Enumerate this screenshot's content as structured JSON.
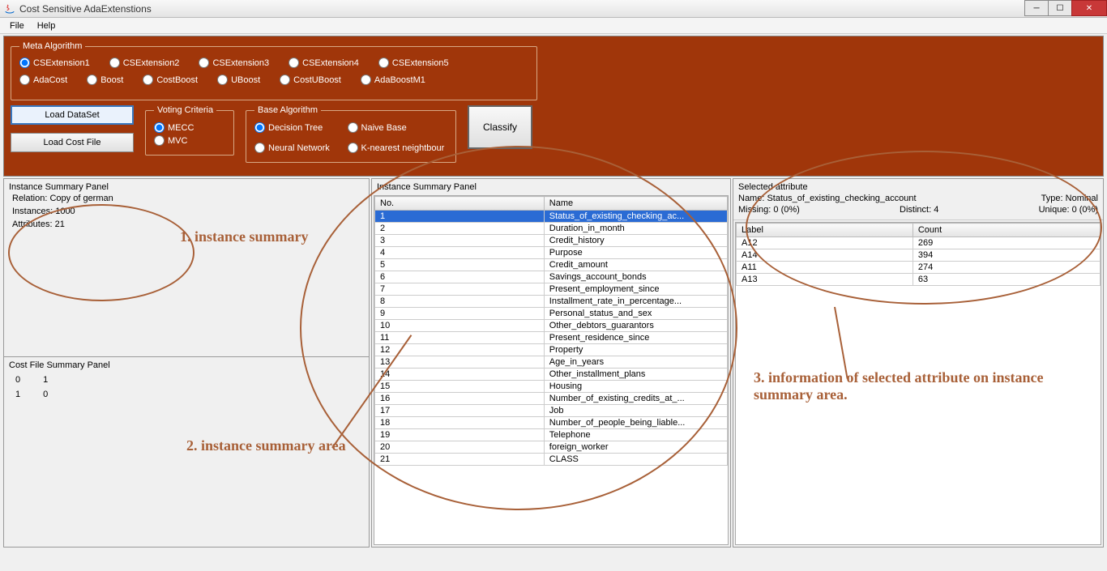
{
  "window": {
    "title": "Cost Sensitive AdaExtenstions"
  },
  "menu": {
    "file": "File",
    "help": "Help"
  },
  "meta": {
    "legend": "Meta Algorithm",
    "row1": [
      "CSExtension1",
      "CSExtension2",
      "CSExtension3",
      "CSExtension4",
      "CSExtension5"
    ],
    "row2": [
      "AdaCost",
      "Boost",
      "CostBoost",
      "UBoost",
      "CostUBoost",
      "AdaBoostM1"
    ],
    "selected": "CSExtension1"
  },
  "buttons": {
    "load_dataset": "Load DataSet",
    "load_costfile": "Load Cost File",
    "classify": "Classify"
  },
  "voting": {
    "legend": "Voting Criteria",
    "options": [
      "MECC",
      "MVC"
    ],
    "selected": "MECC"
  },
  "base": {
    "legend": "Base Algorithm",
    "options": [
      "Decision Tree",
      "Naive Base",
      "Neural Network",
      "K-nearest neightbour"
    ],
    "selected": "Decision Tree"
  },
  "instance_summary": {
    "title": "Instance Summary Panel",
    "relation_label": "Relation:",
    "relation": "Copy of german",
    "instances_label": "Instances:",
    "instances": "1000",
    "attributes_label": "Attributes:",
    "attributes": "21"
  },
  "cost_summary": {
    "title": "Cost File Summary Panel",
    "rows": [
      [
        "0",
        "1"
      ],
      [
        "1",
        "0"
      ]
    ]
  },
  "attribute_panel": {
    "title": "Instance Summary Panel",
    "col_no": "No.",
    "col_name": "Name",
    "rows": [
      {
        "no": "1",
        "name": "Status_of_existing_checking_ac...",
        "selected": true
      },
      {
        "no": "2",
        "name": "Duration_in_month"
      },
      {
        "no": "3",
        "name": "Credit_history"
      },
      {
        "no": "4",
        "name": "Purpose"
      },
      {
        "no": "5",
        "name": "Credit_amount"
      },
      {
        "no": "6",
        "name": "Savings_account_bonds"
      },
      {
        "no": "7",
        "name": "Present_employment_since"
      },
      {
        "no": "8",
        "name": "Installment_rate_in_percentage..."
      },
      {
        "no": "9",
        "name": "Personal_status_and_sex"
      },
      {
        "no": "10",
        "name": "Other_debtors_guarantors"
      },
      {
        "no": "11",
        "name": "Present_residence_since"
      },
      {
        "no": "12",
        "name": "Property"
      },
      {
        "no": "13",
        "name": "Age_in_years"
      },
      {
        "no": "14",
        "name": "Other_installment_plans"
      },
      {
        "no": "15",
        "name": "Housing"
      },
      {
        "no": "16",
        "name": "Number_of_existing_credits_at_..."
      },
      {
        "no": "17",
        "name": "Job"
      },
      {
        "no": "18",
        "name": "Number_of_people_being_liable..."
      },
      {
        "no": "19",
        "name": "Telephone"
      },
      {
        "no": "20",
        "name": "foreign_worker"
      },
      {
        "no": "21",
        "name": "CLASS"
      }
    ]
  },
  "selected_attr": {
    "title": "Selected attribute",
    "name_label": "Name:",
    "name": "Status_of_existing_checking_account",
    "type_label": "Type:",
    "type": "Nominal",
    "missing_label": "Missing:",
    "missing": "0 (0%)",
    "distinct_label": "Distinct:",
    "distinct": "4",
    "unique_label": "Unique:",
    "unique": "0 (0%)",
    "col_label": "Label",
    "col_count": "Count",
    "rows": [
      {
        "label": "A12",
        "count": "269"
      },
      {
        "label": "A14",
        "count": "394"
      },
      {
        "label": "A11",
        "count": "274"
      },
      {
        "label": "A13",
        "count": "63"
      }
    ]
  },
  "annotations": {
    "a1": "1. instance summary",
    "a2": "2. instance summary area",
    "a3": "3. information of selected attribute on instance summary area."
  }
}
